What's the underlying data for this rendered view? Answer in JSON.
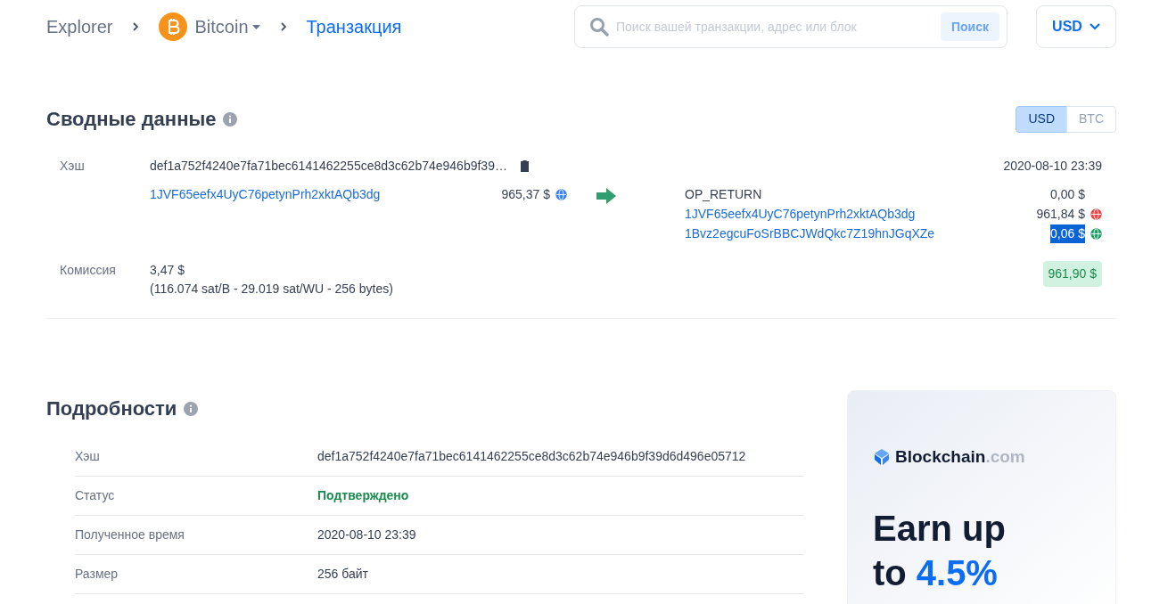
{
  "breadcrumb": {
    "root": "Explorer",
    "coin": "Bitcoin",
    "current": "Транзакция"
  },
  "search": {
    "placeholder": "Поиск вашей транзакции, адрес или блок",
    "button": "Поиск"
  },
  "currency_dropdown": {
    "value": "USD"
  },
  "summary": {
    "title": "Сводные данные",
    "currency_toggle": [
      {
        "label": "USD",
        "selected": true
      },
      {
        "label": "BTC",
        "selected": false
      }
    ],
    "hash_label": "Хэш",
    "hash": "def1a752f4240e7fa71bec6141462255ce8d3c62b74e946b9f39…",
    "time": "2020-08-10 23:39",
    "inputs": [
      {
        "address": "1JVF65eefx4UyC76petynPrh2xktAQb3dg",
        "amount": "965,37 $",
        "color": "#3b82f6"
      }
    ],
    "outputs": [
      {
        "kind": "data",
        "address": "OP_RETURN",
        "amount": "0,00 $",
        "highlighted": false
      },
      {
        "kind": "address",
        "address": "1JVF65eefx4UyC76petynPrh2xktAQb3dg",
        "amount": "961,84 $",
        "color": "#ef4444",
        "highlighted": false
      },
      {
        "kind": "address",
        "address": "1Bvz2egcuFoSrBBCJWdQkc7Z19hnJGqXZe",
        "amount": "0,06 $",
        "color": "#22a06b",
        "highlighted": true
      }
    ],
    "fee_label": "Комиссия",
    "fee": "3,47 $",
    "fee_detail": "(116.074 sat/B - 29.019 sat/WU - 256 bytes)",
    "total": "961,90 $"
  },
  "details": {
    "title": "Подробности",
    "rows": [
      {
        "label": "Хэш",
        "value": "def1a752f4240e7fa71bec6141462255ce8d3c62b74e946b9f39d6d496e05712",
        "kind": "plain"
      },
      {
        "label": "Статус",
        "value": "Подтверждено",
        "kind": "status"
      },
      {
        "label": "Полученное время",
        "value": "2020-08-10 23:39",
        "kind": "plain"
      },
      {
        "label": "Размер",
        "value": "256 байт",
        "kind": "plain"
      }
    ]
  },
  "ad": {
    "brand": "Blockchain",
    "brand_suffix": ".com",
    "headline_1": "Earn up",
    "headline_2": "to",
    "headline_accent": "4.5%"
  }
}
